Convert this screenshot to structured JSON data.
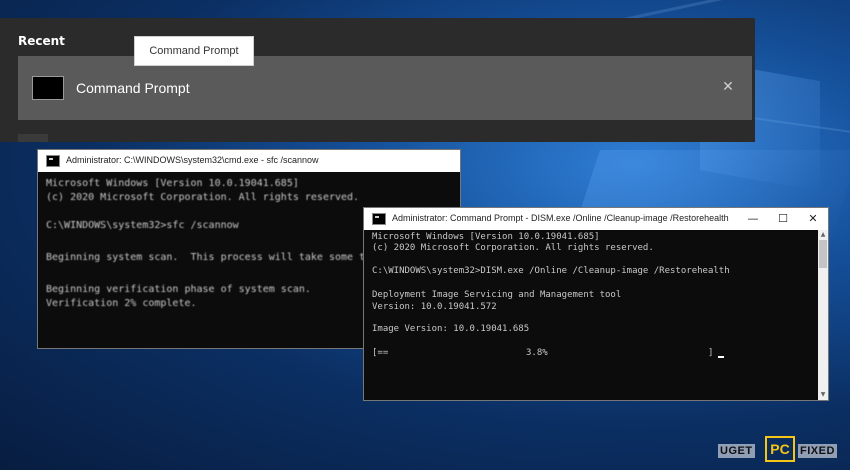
{
  "start_menu": {
    "section_label": "Recent",
    "tooltip": "Command Prompt",
    "result": {
      "label": "Command Prompt",
      "icon": "command-prompt-icon",
      "close_glyph": "✕"
    }
  },
  "sfc_window": {
    "title": "Administrator: C:\\WINDOWS\\system32\\cmd.exe - sfc  /scannow",
    "lines": [
      "Microsoft Windows [Version 10.0.19041.685]",
      "(c) 2020 Microsoft Corporation. All rights reserved.",
      "",
      "C:\\WINDOWS\\system32>sfc /scannow",
      "",
      "Beginning system scan.  This process will take some t",
      "",
      "Beginning verification phase of system scan.",
      "Verification 2% complete."
    ]
  },
  "dism_window": {
    "title": "Administrator: Command Prompt - DISM.exe  /Online /Cleanup-image /Restorehealth",
    "buttons": {
      "minimize": "—",
      "maximize": "☐",
      "close": "✕"
    },
    "lines": [
      "Microsoft Windows [Version 10.0.19041.685]",
      "(c) 2020 Microsoft Corporation. All rights reserved.",
      "",
      "C:\\WINDOWS\\system32>DISM.exe /Online /Cleanup-image /Restorehealth",
      "",
      "Deployment Image Servicing and Management tool",
      "Version: 10.0.19041.572",
      "",
      "Image Version: 10.0.19041.685"
    ],
    "progress": {
      "left": "[==",
      "percent_text": "3.8%",
      "right": "]",
      "value_percent": 3.8
    }
  },
  "watermark": {
    "left": "UGET",
    "center": "PC",
    "right": "FIXED"
  },
  "colors": {
    "console_bg": "#0c0c0c",
    "console_text": "#c8c8c8",
    "start_panel": "#2b2b2b",
    "result_highlight": "#5a5a5a",
    "logo_accent": "#f5c518"
  }
}
